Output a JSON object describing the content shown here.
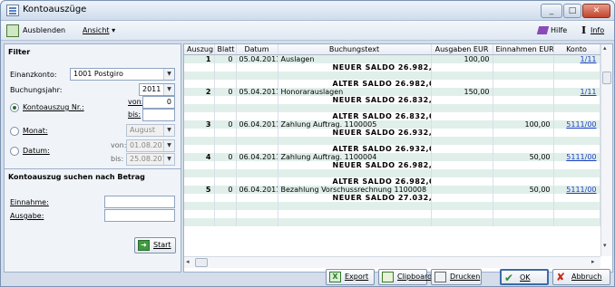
{
  "window": {
    "title": "Kontoauszüge"
  },
  "toolbar": {
    "hide_label": "Ausblenden",
    "view_label": "Ansicht",
    "help_label": "Hilfe",
    "info_label": "Info"
  },
  "filter": {
    "heading": "Filter",
    "account_label": "Einanzkonto:",
    "account_value": "1001 Postgiro",
    "year_label": "Buchungsjahr:",
    "year_value": "2011",
    "statement_label": "Kontoauszug Nr.:",
    "from_label": "von:",
    "from_value": "0",
    "to_label": "bis:",
    "to_value": "",
    "month_label": "Monat:",
    "month_value": "August",
    "date_label": "Datum:",
    "date_from_label": "von:",
    "date_from_value": "01.08.2011",
    "date_to_label": "bis:",
    "date_to_value": "25.08.2011"
  },
  "amount_search": {
    "heading": "Kontoauszug suchen nach Betrag",
    "income_label": "Einnahme:",
    "expense_label": "Ausgabe:",
    "start_label": "Start"
  },
  "table": {
    "columns": [
      "Auszug",
      "Blatt",
      "Datum",
      "Buchungstext",
      "Ausgaben EUR",
      "Einnahmen EUR",
      "Konto"
    ],
    "rows": [
      [
        "1",
        "0",
        "05.04.2011",
        "Auslagen",
        "100,00",
        "",
        "1/11"
      ],
      [
        "",
        "",
        "",
        "NEUER SALDO      26.982,00",
        "",
        "",
        ""
      ],
      [
        "",
        "",
        "",
        "",
        "",
        "",
        ""
      ],
      [
        "",
        "",
        "",
        "ALTER SALDO      26.982,00",
        "",
        "",
        ""
      ],
      [
        "2",
        "0",
        "05.04.2011",
        "Honorarauslagen",
        "150,00",
        "",
        "1/11"
      ],
      [
        "",
        "",
        "",
        "NEUER SALDO      26.832,00",
        "",
        "",
        ""
      ],
      [
        "",
        "",
        "",
        "",
        "",
        "",
        ""
      ],
      [
        "",
        "",
        "",
        "ALTER SALDO      26.832,00",
        "",
        "",
        ""
      ],
      [
        "3",
        "0",
        "06.04.2011",
        "Zahlung Auftrag. 1100005",
        "",
        "100,00",
        "5111/00"
      ],
      [
        "",
        "",
        "",
        "NEUER SALDO      26.932,00",
        "",
        "",
        ""
      ],
      [
        "",
        "",
        "",
        "",
        "",
        "",
        ""
      ],
      [
        "",
        "",
        "",
        "ALTER SALDO      26.932,00",
        "",
        "",
        ""
      ],
      [
        "4",
        "0",
        "06.04.2011",
        "Zahlung Auftrag. 1100004",
        "",
        "50,00",
        "5111/00"
      ],
      [
        "",
        "",
        "",
        "NEUER SALDO      26.982,00",
        "",
        "",
        ""
      ],
      [
        "",
        "",
        "",
        "",
        "",
        "",
        ""
      ],
      [
        "",
        "",
        "",
        "ALTER SALDO      26.982,00",
        "",
        "",
        ""
      ],
      [
        "5",
        "0",
        "06.04.2011",
        "Bezahlung Vorschussrechnung 1100008",
        "",
        "50,00",
        "5111/00"
      ],
      [
        "",
        "",
        "",
        "NEUER SALDO      27.032,00",
        "",
        "",
        ""
      ],
      [
        "",
        "",
        "",
        "",
        "",
        "",
        ""
      ],
      [
        "",
        "",
        "",
        "",
        "",
        "",
        ""
      ],
      [
        "",
        "",
        "",
        "",
        "",
        "",
        ""
      ]
    ]
  },
  "footer": {
    "export_label": "Export",
    "clipboard_label": "Clipboard",
    "print_label": "Drucken",
    "ok_label": "OK",
    "cancel_label": "Abbruch"
  },
  "colors": {
    "row_alt": "#e1efea",
    "link": "#1a3ec2",
    "accent": "#2a6f2a"
  }
}
